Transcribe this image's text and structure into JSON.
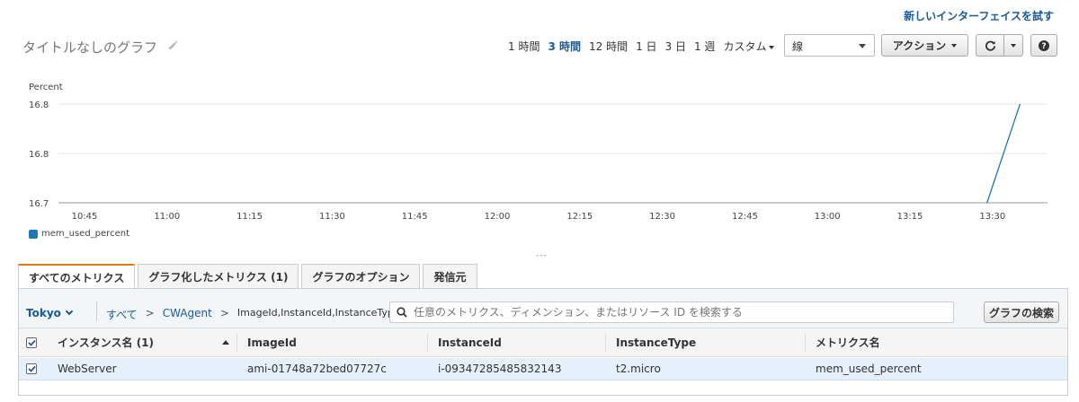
{
  "header": {
    "new_interface_link": "新しいインターフェイスを試す",
    "graph_title": "タイトルなしのグラフ"
  },
  "time_ranges": [
    "1 時間",
    "3 時間",
    "12 時間",
    "1 日",
    "3 日",
    "1 週",
    "カスタム"
  ],
  "active_range": "3 時間",
  "graph_type_select": "線",
  "action_button": "アクション",
  "chart_data": {
    "type": "line",
    "ylabel": "Percent",
    "y_ticks": [
      "16.8",
      "16.8",
      "16.7"
    ],
    "x_ticks": [
      "10:45",
      "11:00",
      "11:15",
      "11:30",
      "11:45",
      "12:00",
      "12:15",
      "12:30",
      "12:45",
      "13:00",
      "13:15",
      "13:30"
    ],
    "series": [
      {
        "name": "mem_used_percent",
        "color": "#1f77b4",
        "x": [
          "13:29",
          "13:35"
        ],
        "values": [
          16.7,
          16.8
        ]
      }
    ],
    "grid": true,
    "legend_position": "bottom-left"
  },
  "tabs": [
    "すべてのメトリクス",
    "グラフ化したメトリクス (1)",
    "グラフのオプション",
    "発信元"
  ],
  "active_tab": "すべてのメトリクス",
  "browser": {
    "region": "Tokyo",
    "breadcrumb": [
      "すべて",
      "CWAgent",
      "ImageId,InstanceId,InstanceType"
    ],
    "search_placeholder": "任意のメトリクス、ディメンション、またはリソース ID を検索する",
    "search_button": "グラフの検索"
  },
  "table": {
    "columns": [
      "インスタンス名 (1)",
      "ImageId",
      "InstanceId",
      "InstanceType",
      "メトリクス名"
    ],
    "rows": [
      [
        "WebServer",
        "ami-01748a72bed07727c",
        "i-09347285485832143",
        "t2.micro",
        "mem_used_percent"
      ]
    ]
  }
}
